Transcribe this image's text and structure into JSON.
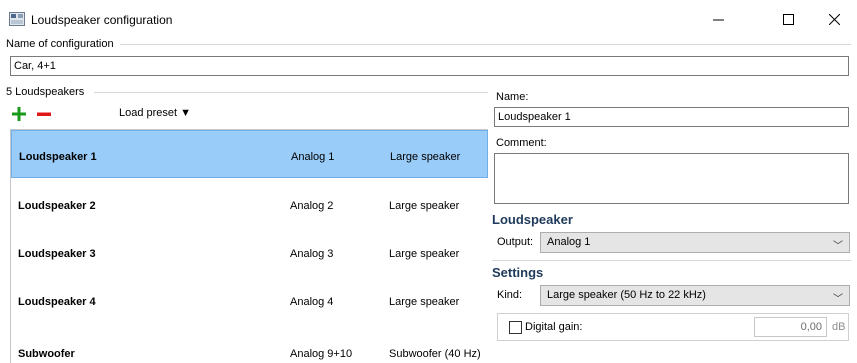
{
  "window": {
    "title": "Loudspeaker configuration",
    "minimize_glyph": "—",
    "maximize_glyph": "☐",
    "close_glyph": "✕"
  },
  "config_name": {
    "label": "Name of configuration",
    "value": "Car, 4+1"
  },
  "speakers_group": {
    "label": "5 Loudspeakers",
    "add_icon": "plus-icon",
    "remove_icon": "minus-icon",
    "load_preset_label": "Load preset ▼"
  },
  "speakers": [
    {
      "name": "Loudspeaker 1",
      "output": "Analog 1",
      "kind": "Large speaker",
      "selected": true
    },
    {
      "name": "Loudspeaker 2",
      "output": "Analog 2",
      "kind": "Large speaker",
      "selected": false
    },
    {
      "name": "Loudspeaker 3",
      "output": "Analog 3",
      "kind": "Large speaker",
      "selected": false
    },
    {
      "name": "Loudspeaker 4",
      "output": "Analog 4",
      "kind": "Large speaker",
      "selected": false
    },
    {
      "name": "Subwoofer",
      "output": "Analog 9+10",
      "kind": "Subwoofer (40 Hz)",
      "selected": false
    }
  ],
  "details": {
    "name_label": "Name:",
    "name_value": "Loudspeaker 1",
    "comment_label": "Comment:",
    "comment_value": "",
    "loudspeaker_section": "Loudspeaker",
    "output_label": "Output:",
    "output_value": "Analog 1",
    "settings_section": "Settings",
    "kind_label": "Kind:",
    "kind_value": "Large speaker (50 Hz to 22 kHz)",
    "digital_gain_label": "Digital gain:",
    "digital_gain_checked": false,
    "digital_gain_value": "0,00",
    "digital_gain_unit": "dB"
  },
  "colors": {
    "selection_bg": "#99ccf9",
    "add_green": "#1a9a1a",
    "remove_red": "#e01818",
    "section_heading": "#1f3a5a"
  }
}
